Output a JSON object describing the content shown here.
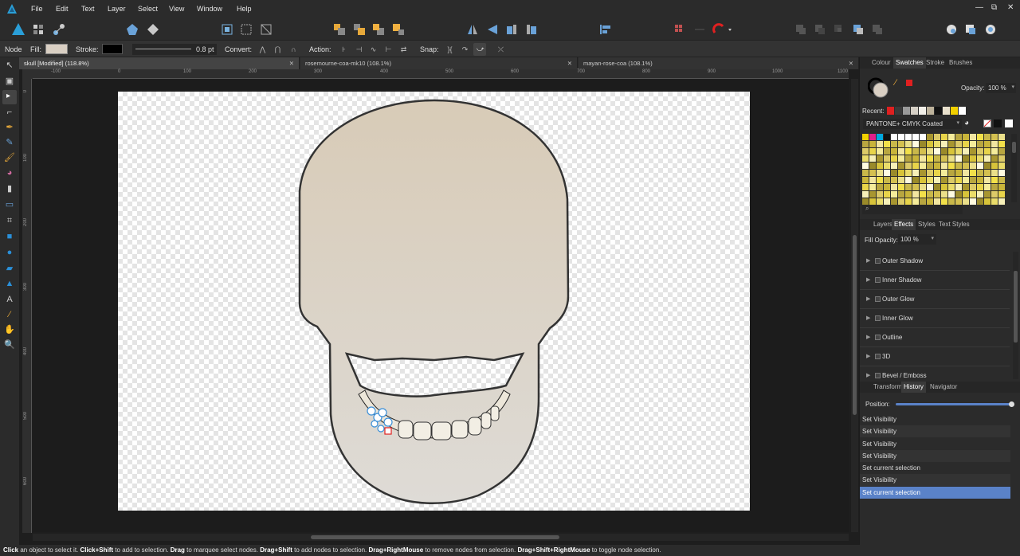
{
  "menu": {
    "items": [
      "File",
      "Edit",
      "Text",
      "Layer",
      "Select",
      "View",
      "Window",
      "Help"
    ],
    "window_controls": [
      "—",
      "⧉",
      "✕"
    ]
  },
  "context": {
    "tool": "Node",
    "fill_label": "Fill:",
    "stroke_label": "Stroke:",
    "stroke_width": "0.8 pt",
    "convert_label": "Convert:",
    "action_label": "Action:",
    "snap_label": "Snap:"
  },
  "tabs": [
    {
      "label": "skull [Modified] (118.8%)"
    },
    {
      "label": "rosemourne-coa-mk10 (108.1%)"
    },
    {
      "label": "mayan-rose-coa (108.1%)"
    }
  ],
  "ruler": {
    "h": [
      "-100",
      "0",
      "100",
      "200",
      "300",
      "400",
      "500",
      "600",
      "700",
      "800",
      "900",
      "1000",
      "1100"
    ],
    "v": [
      "0",
      "100",
      "200",
      "300",
      "400",
      "500",
      "600"
    ]
  },
  "panels": {
    "top_tabs": [
      "Colour",
      "Swatches",
      "Stroke",
      "Brushes"
    ],
    "opacity_label": "Opacity:",
    "opacity_value": "100 %",
    "recent_label": "Recent:",
    "palette_name": "PANTONE+ CMYK Coated",
    "mid_tabs": [
      "Layers",
      "Effects",
      "Styles",
      "Text Styles"
    ],
    "fill_opacity_label": "Fill Opacity:",
    "fill_opacity_value": "100 %",
    "effects": [
      "Outer Shadow",
      "Inner Shadow",
      "Outer Glow",
      "Inner Glow",
      "Outline",
      "3D",
      "Bevel / Emboss"
    ],
    "bottom_tabs": [
      "Transform",
      "History",
      "Navigator"
    ],
    "position_label": "Position:",
    "history": [
      "Set Visibility",
      "Set Visibility",
      "Set Visibility",
      "Set Visibility",
      "Set current selection",
      "Set Visibility",
      "Set current selection"
    ]
  },
  "colors": {
    "fill": "#d9cfc3",
    "stroke": "#000000",
    "history_selected": "#5a82c8",
    "accent_red": "#e02020"
  },
  "status": {
    "parts": [
      {
        "b": "Click",
        "t": " an object to select it. "
      },
      {
        "b": "Click+Shift",
        "t": " to add to selection. "
      },
      {
        "b": "Drag",
        "t": " to marquee select nodes. "
      },
      {
        "b": "Drag+Shift",
        "t": " to add nodes to selection. "
      },
      {
        "b": "Drag+RightMouse",
        "t": " to remove nodes from selection. "
      },
      {
        "b": "Drag+Shift+RightMouse",
        "t": " to toggle node selection."
      }
    ]
  }
}
